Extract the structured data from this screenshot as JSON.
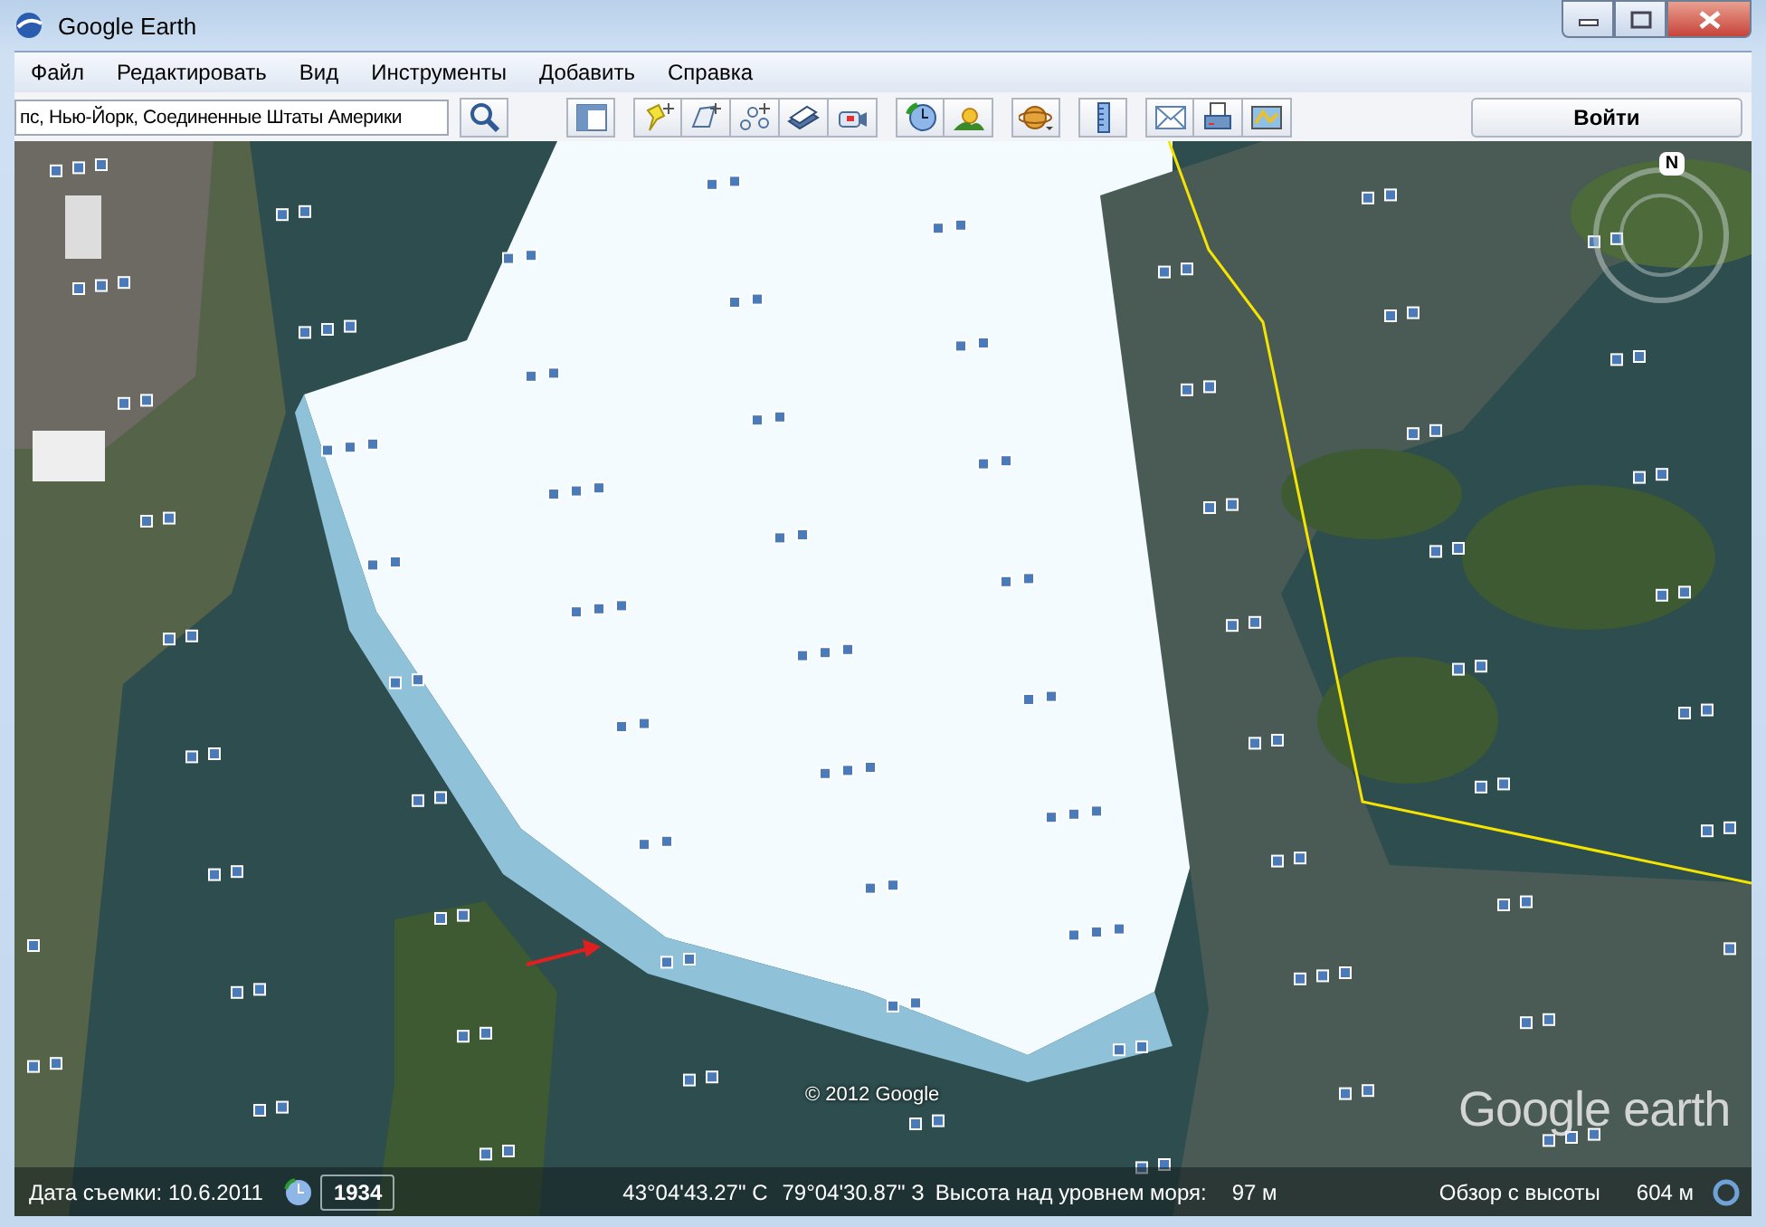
{
  "window": {
    "title": "Google Earth"
  },
  "menu": [
    "Файл",
    "Редактировать",
    "Вид",
    "Инструменты",
    "Добавить",
    "Справка"
  ],
  "search": {
    "value": "пс, Нью-Йорк, Соединенные Штаты Америки"
  },
  "sign_in_button": "Войти",
  "map": {
    "compass": "N",
    "copyright": "© 2012 Google",
    "logo": "Google earth"
  },
  "status_bar": {
    "imagery_date": "Дата съемки: 10.6.2011",
    "historical_year": "1934",
    "latitude": "43°04'43.27\" С",
    "longitude": "79°04'30.87\" З",
    "elevation_label": "Высота над уровнем моря:",
    "elevation": "97 м",
    "eye_altitude_label": "Обзор с высоты",
    "eye_altitude": "604 м"
  }
}
